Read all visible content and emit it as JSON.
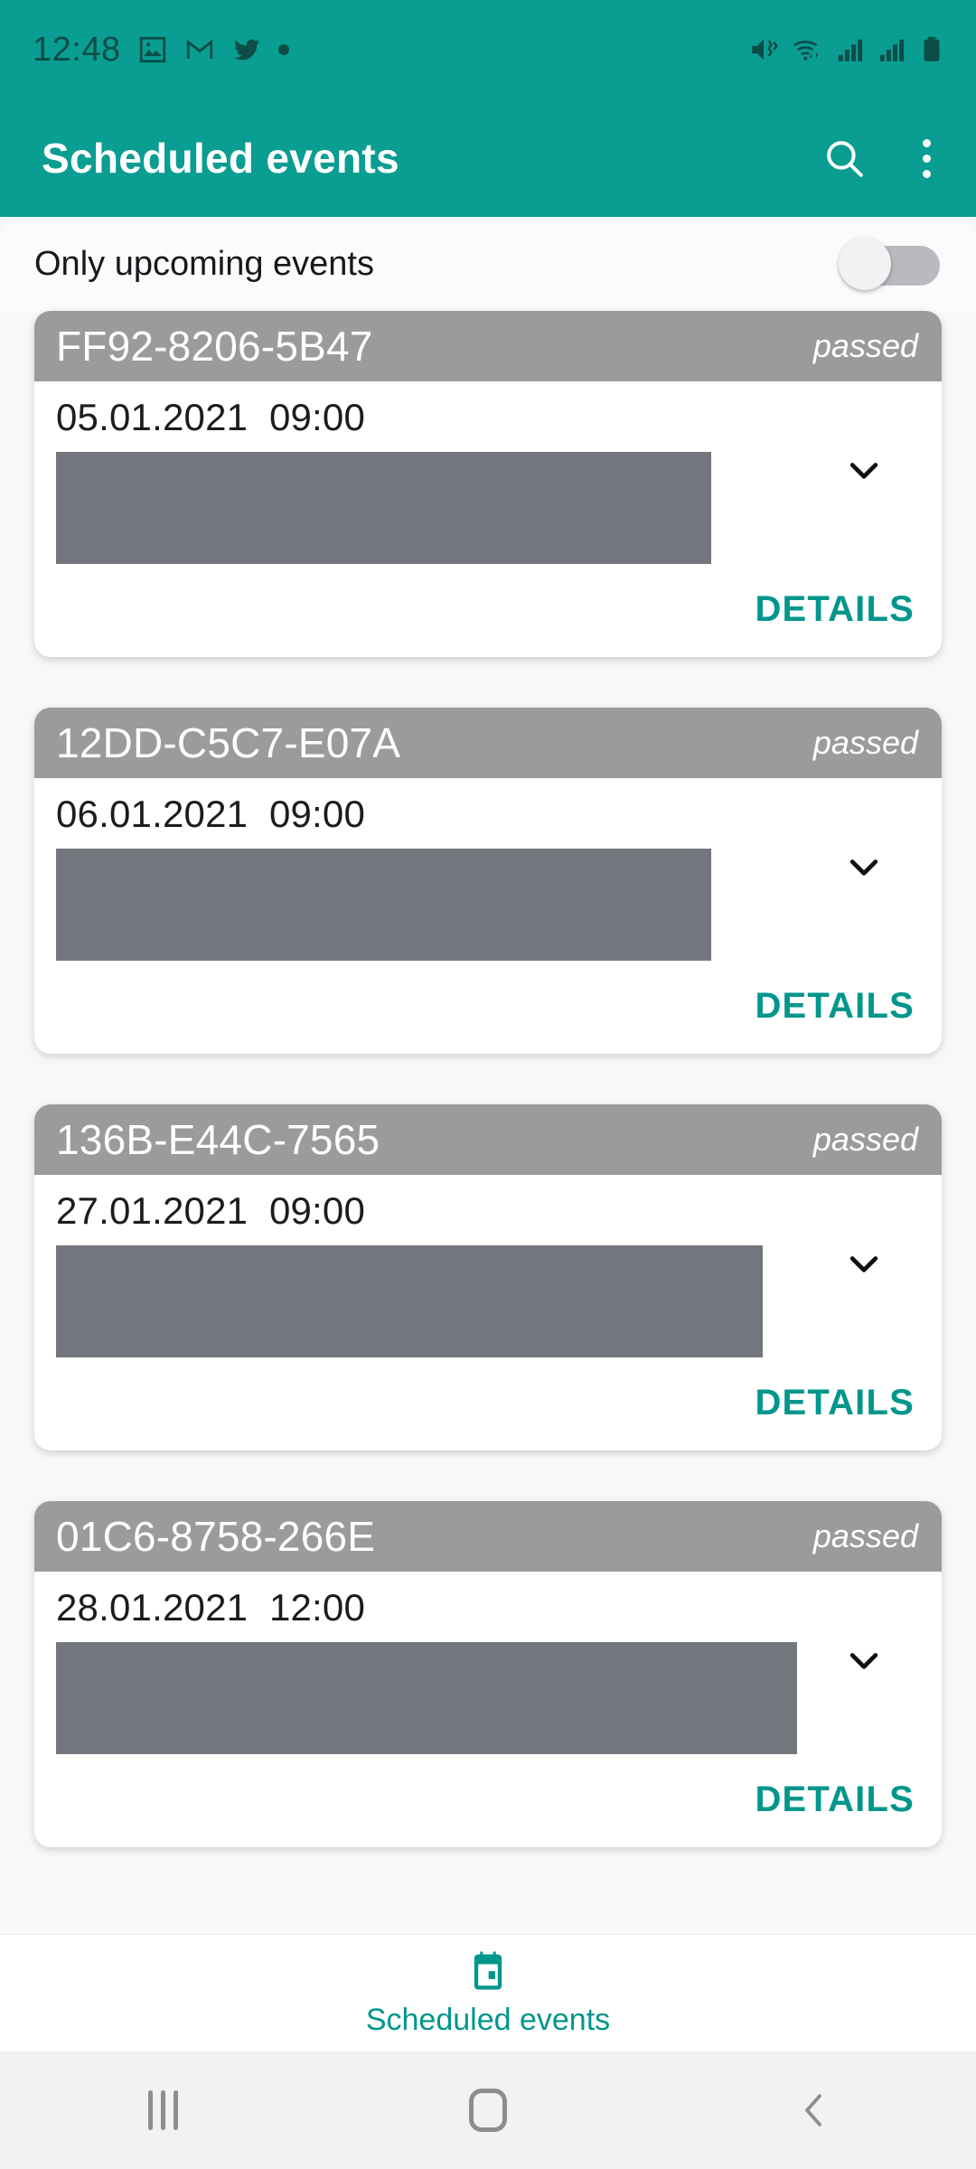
{
  "status_bar": {
    "time": "12:48",
    "left_icons": [
      "image-icon",
      "gmail-icon",
      "twitter-icon",
      "dot-icon"
    ],
    "right_icons": [
      "mute-vibrate-icon",
      "wifi-icon",
      "signal-icon",
      "signal-icon-2",
      "battery-icon"
    ],
    "background_color": "#0a9d92",
    "icon_color": "#0c4d48"
  },
  "app_bar": {
    "title": "Scheduled events",
    "search_icon": "search-icon",
    "overflow_icon": "more-vert-icon",
    "background_color": "#0a9d92",
    "text_color": "#ffffff"
  },
  "filter": {
    "label": "Only upcoming events",
    "toggle_state": "off"
  },
  "events": [
    {
      "id": "FF92-8206-5B47",
      "status": "passed",
      "datetime": "05.01.2021  09:00",
      "redacted_width_pct": 76,
      "expand_icon": "chevron-down-icon",
      "details_label": "DETAILS"
    },
    {
      "id": "12DD-C5C7-E07A",
      "status": "passed",
      "datetime": "06.01.2021  09:00",
      "redacted_width_pct": 76,
      "expand_icon": "chevron-down-icon",
      "details_label": "DETAILS"
    },
    {
      "id": "136B-E44C-7565",
      "status": "passed",
      "datetime": "27.01.2021  09:00",
      "redacted_width_pct": 82,
      "expand_icon": "chevron-down-icon",
      "details_label": "DETAILS"
    },
    {
      "id": "01C6-8758-266E",
      "status": "passed",
      "datetime": "28.01.2021  12:00",
      "redacted_width_pct": 86,
      "expand_icon": "chevron-down-icon",
      "details_label": "DETAILS"
    }
  ],
  "bottom_nav": {
    "items": [
      {
        "label": "Scheduled events",
        "icon": "calendar-event-icon",
        "selected": true
      }
    ],
    "active_color": "#00968c"
  },
  "system_nav": {
    "recents_icon": "recents-icon",
    "home_icon": "home-icon",
    "back_icon": "back-icon"
  },
  "colors": {
    "accent": "#0a9d92",
    "details_link": "#00968c",
    "card_header": "#9b9b9b",
    "redacted_block": "#73767c",
    "page_background": "#f7f8fa"
  }
}
